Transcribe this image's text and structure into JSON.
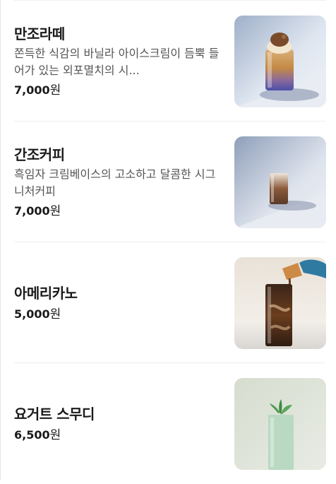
{
  "menu": {
    "items": [
      {
        "name": "만조라떼",
        "description": "쫀득한 식감의 바닐라 아이스크림이 듬뿍 들어가 있는 외포멸치의 시...",
        "price": "7,000",
        "currency": "원",
        "image": "mamjo-latte-photo"
      },
      {
        "name": "간조커피",
        "description": "흑임자 크림베이스의 고소하고 달콤한 시그니처커피",
        "price": "7,000",
        "currency": "원",
        "image": "ganjo-coffee-photo"
      },
      {
        "name": "아메리카노",
        "description": "",
        "price": "5,000",
        "currency": "원",
        "image": "americano-photo"
      },
      {
        "name": "요거트 스무디",
        "description": "",
        "price": "6,500",
        "currency": "원",
        "image": "yogurt-smoothie-photo"
      }
    ]
  }
}
